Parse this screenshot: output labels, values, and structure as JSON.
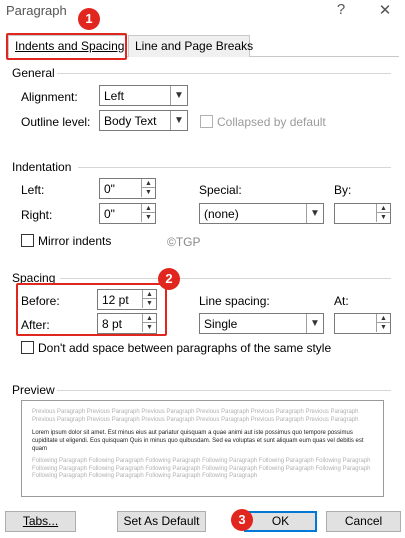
{
  "window": {
    "title": "Paragraph",
    "help_glyph": "?",
    "close_glyph": "✕"
  },
  "tabs": [
    {
      "label": "Indents and Spacing"
    },
    {
      "label": "Line and Page Breaks"
    }
  ],
  "badges": [
    "1",
    "2",
    "3"
  ],
  "general": {
    "heading": "General",
    "alignment_label": "Alignment:",
    "alignment_value": "Left",
    "outline_label": "Outline level:",
    "outline_value": "Body Text",
    "collapsed_label": "Collapsed by default"
  },
  "indentation": {
    "heading": "Indentation",
    "left_label": "Left:",
    "left_value": "0\"",
    "right_label": "Right:",
    "right_value": "0\"",
    "special_label": "Special:",
    "special_value": "(none)",
    "by_label": "By:",
    "by_value": "",
    "mirror_label": "Mirror indents",
    "watermark": "©TGP"
  },
  "spacing": {
    "heading": "Spacing",
    "before_label": "Before:",
    "before_value": "12 pt",
    "after_label": "After:",
    "after_value": "8 pt",
    "line_spacing_label": "Line spacing:",
    "line_spacing_value": "Single",
    "at_label": "At:",
    "at_value": "",
    "dont_add_label": "Don't add space between paragraphs of the same style"
  },
  "preview": {
    "heading": "Preview",
    "prev_text": "Previous Paragraph Previous Paragraph Previous Paragraph Previous Paragraph Previous Paragraph Previous Paragraph Previous Paragraph Previous Paragraph Previous Paragraph Previous Paragraph Previous Paragraph Previous Paragraph",
    "sample_text": "Lorem ipsum dolor sit amet. Est minus eius aut pariatur quisquam a quae animi aut iste possimus quo tempore possimus cupiditate ut eligendi. Eos quisquam Quis in minus quo quibusdam. Sed ea voluptas et sunt aliquam eum quas vel debitis est quam",
    "next_text": "Following Paragraph Following Paragraph Following Paragraph Following Paragraph Following Paragraph Following Paragraph Following Paragraph Following Paragraph Following Paragraph Following Paragraph Following Paragraph Following Paragraph Following Paragraph Following Paragraph Following Paragraph Following Paragraph"
  },
  "buttons": {
    "tabs": "Tabs...",
    "set_default": "Set As Default",
    "ok": "OK",
    "cancel": "Cancel"
  },
  "colors": {
    "annotation_red": "#e0261e",
    "ok_border": "#0078d7"
  }
}
